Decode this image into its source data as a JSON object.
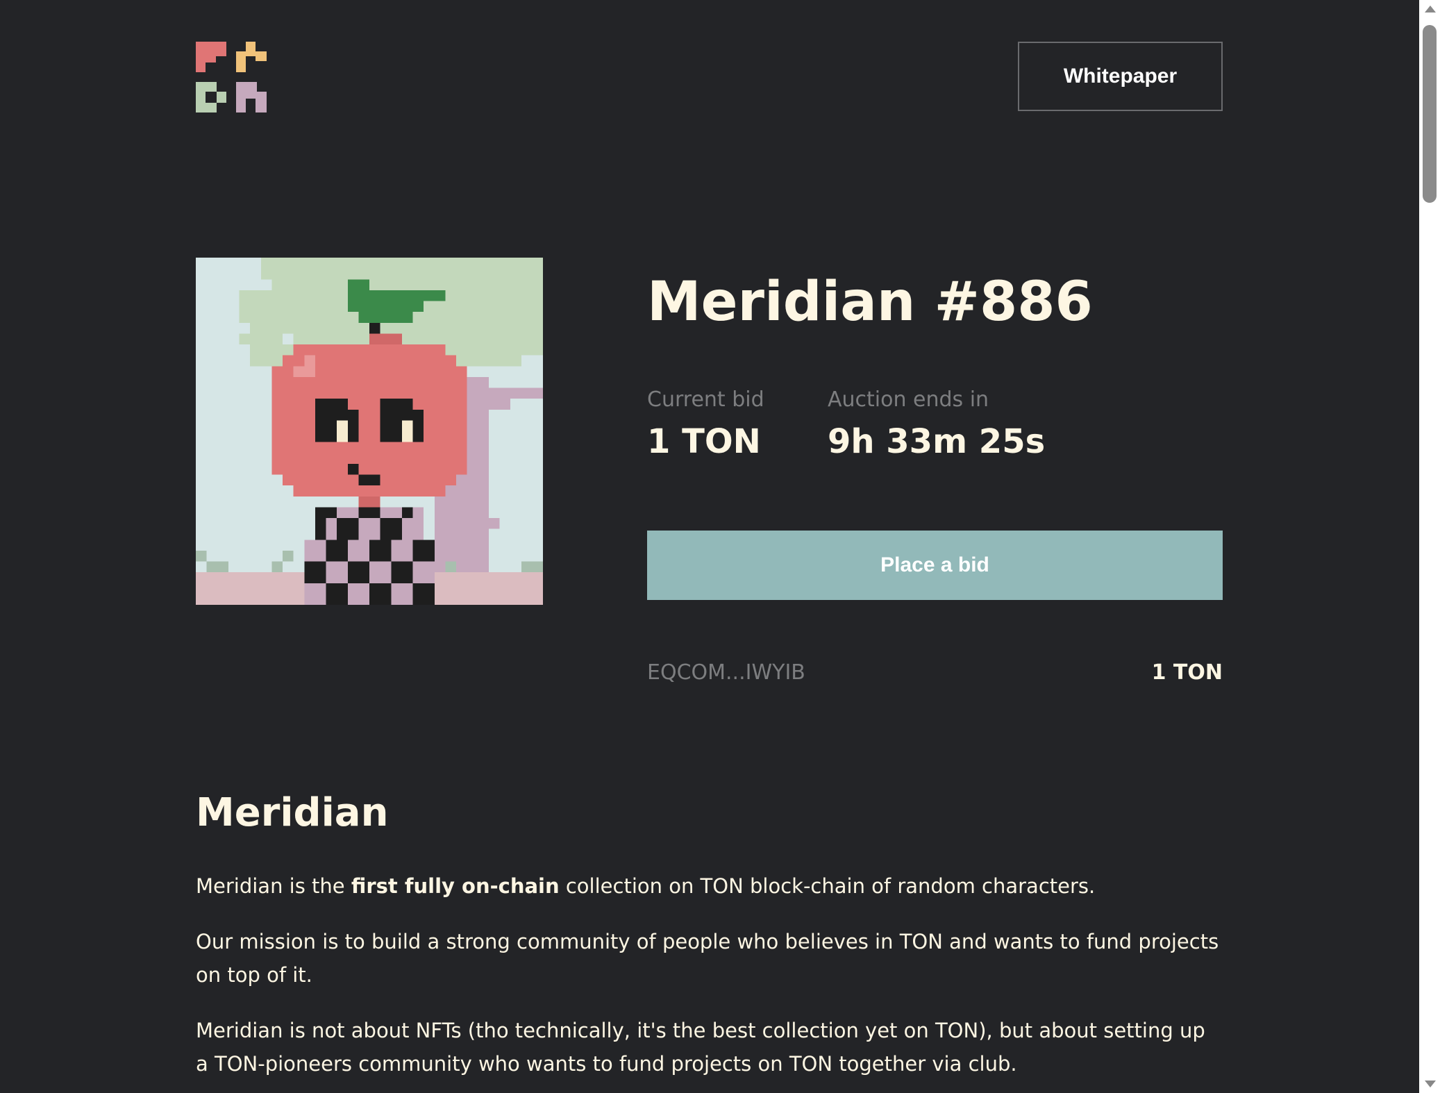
{
  "header": {
    "whitepaper_label": "Whitepaper"
  },
  "nft": {
    "title": "Meridian #886",
    "current_bid_label": "Current bid",
    "current_bid_value": "1 TON",
    "auction_label": "Auction ends in",
    "auction_value": "9h 33m 25s",
    "place_bid_label": "Place a bid",
    "last_bidder": "EQCOM...IWYIB",
    "last_bid_amount": "1 TON"
  },
  "about": {
    "heading": "Meridian",
    "p1_before": "Meridian is the ",
    "p1_bold": "first fully on-chain",
    "p1_after": " collection on TON block-chain of random characters.",
    "p2": "Our mission is to build a strong community of people who believes in TON and wants to fund projects on top of it.",
    "p3": "Meridian is not about NFTs (tho technically, it's the best collection yet on TON), but about setting up a TON-pioneers community who wants to fund projects on TON together via club."
  },
  "colors": {
    "background": "#232427",
    "accent": "#92b9b9",
    "text": "#fdf6e3",
    "muted": "#7d7e80",
    "logo_red": "#e07575",
    "logo_yellow": "#f0c27a",
    "logo_green": "#b9cfb2",
    "logo_purple": "#c6a9bd"
  },
  "icons": {
    "logo": "meridian-pixel-logo",
    "scroll_up": "scroll-up-arrow-icon",
    "scroll_down": "scroll-down-arrow-icon"
  }
}
